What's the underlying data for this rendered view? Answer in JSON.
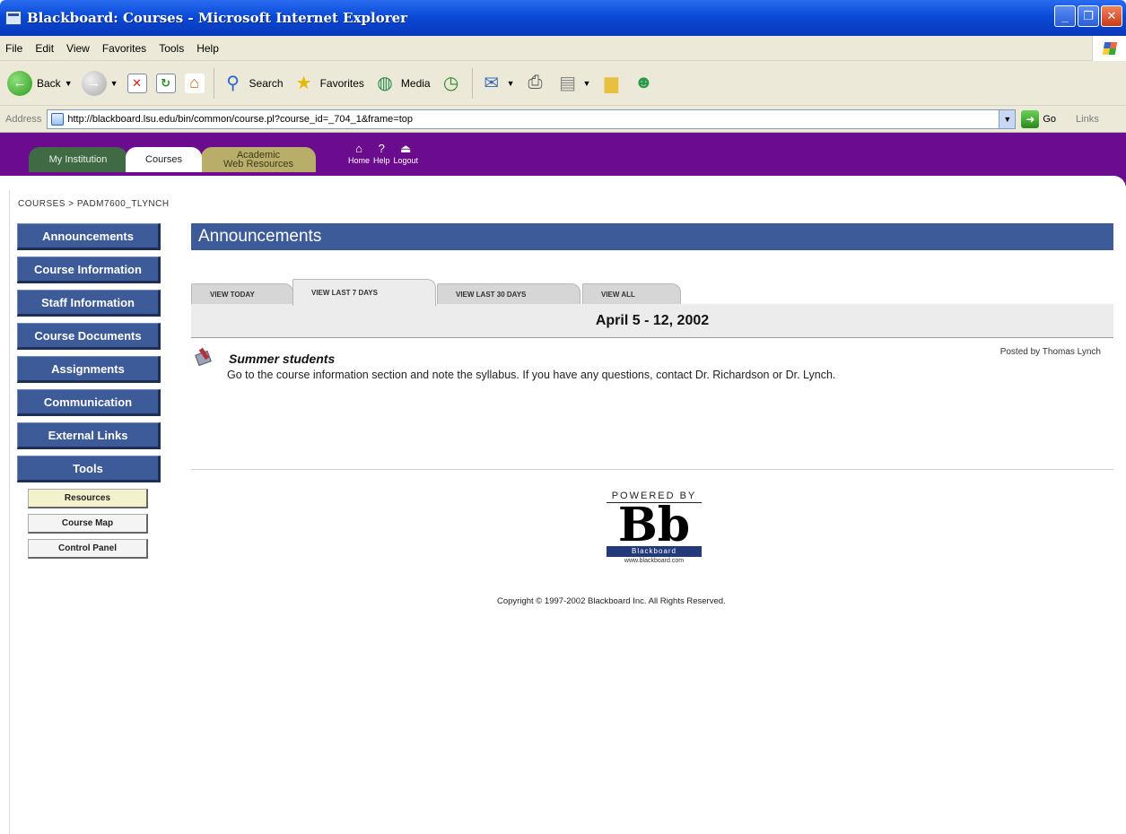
{
  "window": {
    "title": "Blackboard: Courses - Microsoft Internet Explorer"
  },
  "menubar": {
    "items": [
      "File",
      "Edit",
      "View",
      "Favorites",
      "Tools",
      "Help"
    ]
  },
  "toolbar": {
    "back_label": "Back",
    "search_label": "Search",
    "favorites_label": "Favorites",
    "media_label": "Media"
  },
  "addressbar": {
    "label": "Address",
    "url": "http://blackboard.lsu.edu/bin/common/course.pl?course_id=_704_1&frame=top",
    "go_label": "Go",
    "links_label": "Links"
  },
  "bbnav": {
    "tabs": [
      {
        "label": "My Institution"
      },
      {
        "label": "Courses"
      },
      {
        "label_line1": "Academic",
        "label_line2": "Web Resources"
      }
    ],
    "icons": [
      {
        "label": "Home",
        "icon": "home-icon"
      },
      {
        "label": "Help",
        "icon": "help-icon"
      },
      {
        "label": "Logout",
        "icon": "logout-icon"
      }
    ],
    "accent_color": "#6b0c8f"
  },
  "breadcrumb": {
    "root": "COURSES",
    "separator": ">",
    "current": "PADM7600_TLYNCH"
  },
  "sidebar": {
    "items": [
      "Announcements",
      "Course Information",
      "Staff Information",
      "Course Documents",
      "Assignments",
      "Communication",
      "External Links",
      "Tools"
    ],
    "tool_buttons": [
      "Resources",
      "Course Map",
      "Control Panel"
    ],
    "button_color": "#3d5a99"
  },
  "main": {
    "header": "Announcements",
    "tabs": [
      "VIEW TODAY",
      "VIEW LAST 7 DAYS",
      "VIEW LAST 30 DAYS",
      "VIEW ALL"
    ],
    "active_tab": "VIEW LAST 7 DAYS",
    "date_range": "April 5 - 12, 2002",
    "announcement": {
      "title": "Summer students",
      "body": "Go to the course information section and note the syllabus. If you have any questions, contact Dr. Richardson or Dr. Lynch.",
      "posted_by": "Posted by Thomas Lynch"
    }
  },
  "footer": {
    "powered_by": "POWERED BY",
    "logo_text": "Bb",
    "logo_band": "Blackboard",
    "logo_url": "www.blackboard.com",
    "copyright": "Copyright © 1997-2002 Blackboard Inc. All Rights Reserved."
  }
}
